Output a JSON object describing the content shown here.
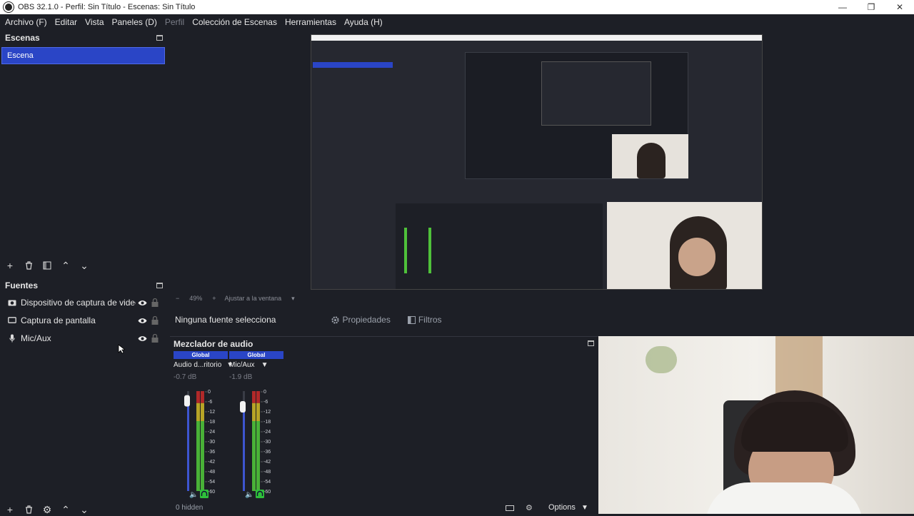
{
  "window": {
    "title": "OBS 32.1.0 - Perfil: Sin Título - Escenas: Sin Título",
    "controls": [
      "minimize",
      "restore",
      "close"
    ]
  },
  "menu": [
    {
      "label": "Archivo (F)",
      "enabled": true
    },
    {
      "label": "Editar",
      "enabled": true
    },
    {
      "label": "Vista",
      "enabled": true
    },
    {
      "label": "Paneles (D)",
      "enabled": true
    },
    {
      "label": "Perfil",
      "enabled": false
    },
    {
      "label": "Colección de Escenas",
      "enabled": true
    },
    {
      "label": "Herramientas",
      "enabled": true
    },
    {
      "label": "Ayuda (H)",
      "enabled": true
    }
  ],
  "scenes": {
    "title": "Escenas",
    "items": [
      {
        "label": "Escena",
        "selected": true
      }
    ],
    "toolbar": [
      "add-icon",
      "trash-icon",
      "filter-icon",
      "up-icon",
      "down-icon"
    ]
  },
  "sources": {
    "title": "Fuentes",
    "items": [
      {
        "label": "Dispositivo de captura de videc",
        "icon": "camera-icon"
      },
      {
        "label": "Captura de pantalla",
        "icon": "monitor-icon"
      },
      {
        "label": "Mic/Aux",
        "icon": "mic-icon"
      }
    ],
    "toolbar": [
      "add-icon",
      "trash-icon",
      "gear-icon",
      "up-icon",
      "down-icon"
    ]
  },
  "context": {
    "none_selected": "Ninguna fuente selecciona",
    "properties": "Propiedades",
    "filters": "Filtros"
  },
  "zoom": {
    "level": "49%",
    "fit": "Ajustar a la ventana"
  },
  "mixer": {
    "title": "Mezclador de audio",
    "channels": [
      {
        "badge": "Global",
        "name": "Audio d...ritorio",
        "db": "-0.7 dB",
        "fader_level": 0.96
      },
      {
        "badge": "Global",
        "name": "Mic/Aux",
        "db": "-1.9 dB",
        "fader_level": 0.9
      }
    ],
    "scale": [
      "0",
      "-6",
      "-12",
      "-18",
      "-24",
      "-30",
      "-36",
      "-42",
      "-48",
      "-54",
      "-60"
    ],
    "hidden_label": "0 hidden",
    "options_label": "Options"
  },
  "colors": {
    "accent": "#2a45c6",
    "background": "#1d1f26",
    "meter_green": "#4fc13a",
    "meter_yellow": "#c9b227",
    "meter_red": "#c22a2a"
  }
}
